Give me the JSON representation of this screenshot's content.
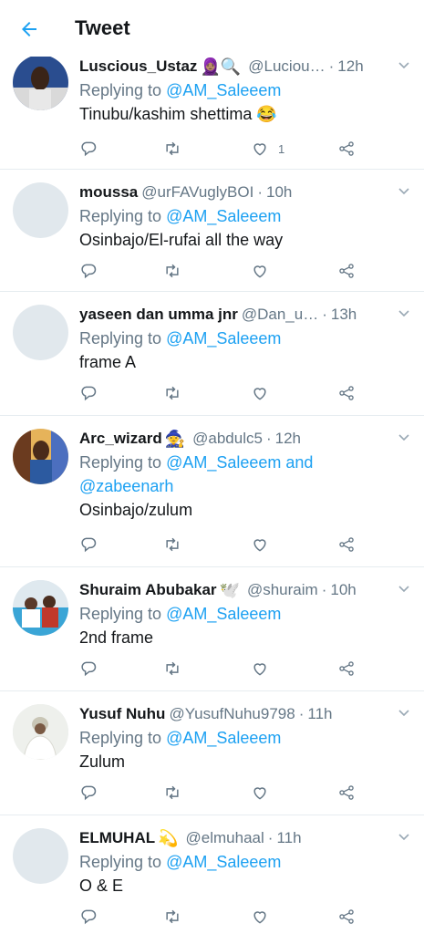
{
  "header": {
    "title": "Tweet"
  },
  "reply_prefix": "Replying to",
  "tweets": [
    {
      "name": "Luscious_Ustaz",
      "emoji": "🧕🏽🔍",
      "handle": "@Luciou…",
      "time": "12h",
      "replying": "@AM_Saleeem",
      "text": "Tinubu/kashim shettima 😂",
      "likes": "1",
      "avatar": "photo"
    },
    {
      "name": "moussa",
      "emoji": "",
      "handle": "@urFAVuglyBOI",
      "time": "10h",
      "replying": "@AM_Saleeem",
      "text": "Osinbajo/El-rufai all the way",
      "likes": "",
      "avatar": "blank"
    },
    {
      "name": "yaseen dan umma jnr",
      "emoji": "",
      "handle": "@Dan_u…",
      "time": "13h",
      "replying": "@AM_Saleeem",
      "text": "frame A",
      "likes": "",
      "avatar": "blank"
    },
    {
      "name": "Arc_wizard",
      "emoji": "🧙",
      "handle": "@abdulc5",
      "time": "12h",
      "replying": "@AM_Saleeem and",
      "replying2": "@zabeenarh",
      "text": "Osinbajo/zulum",
      "likes": "",
      "avatar": "photo2"
    },
    {
      "name": "Shuraim Abubakar",
      "emoji": "🕊️",
      "handle": "@shuraim",
      "time": "10h",
      "replying": "@AM_Saleeem",
      "text": "2nd frame",
      "likes": "",
      "avatar": "photo3"
    },
    {
      "name": "Yusuf Nuhu",
      "emoji": "",
      "handle": "@YusufNuhu9798",
      "time": "11h",
      "replying": "@AM_Saleeem",
      "text": "Zulum",
      "likes": "",
      "avatar": "photo4"
    },
    {
      "name": "ELMUHAL",
      "emoji": "💫",
      "handle": "@elmuhaal",
      "time": "11h",
      "replying": "@AM_Saleeem",
      "text": "O & E",
      "likes": "",
      "avatar": "blank"
    }
  ],
  "colors": {
    "accent": "#1da1f2",
    "muted": "#657786",
    "text": "#14171a",
    "divider": "#e6ecf0"
  },
  "icons": [
    "back-arrow-icon",
    "reply-icon",
    "retweet-icon",
    "like-icon",
    "share-icon",
    "chevron-down-icon"
  ]
}
